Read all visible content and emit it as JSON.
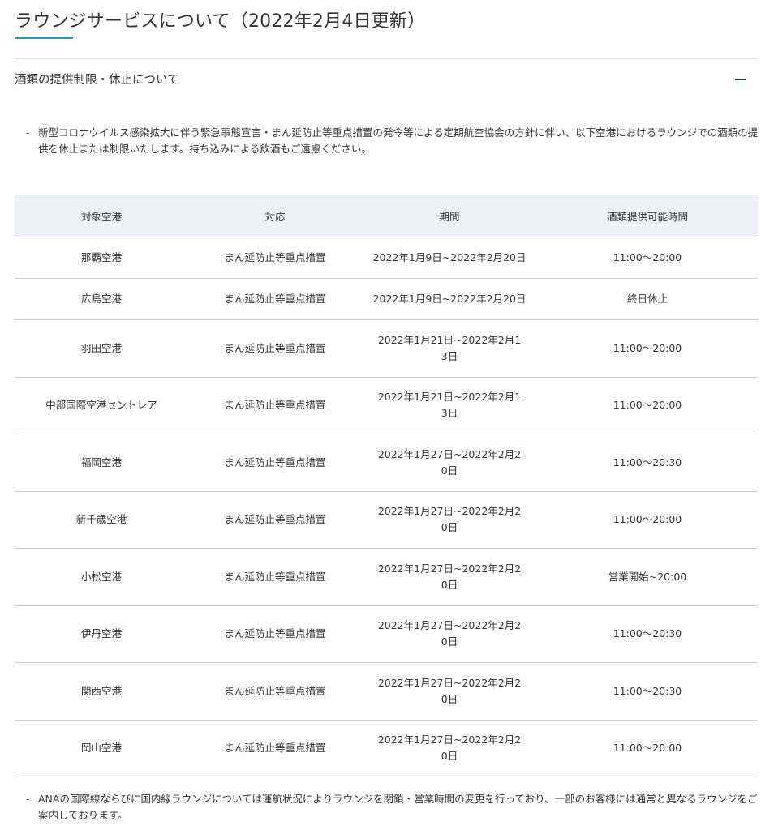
{
  "page": {
    "title": "ラウンジサービスについて（2022年2月4日更新）"
  },
  "accordion": {
    "title": "酒類の提供制限・休止について",
    "toggle_icon": "minus-icon"
  },
  "notes": {
    "top_dash": "-",
    "top": "新型コロナウイルス感染拡大に伴う緊急事態宣言・まん延防止等重点措置の発令等による定期航空協会の方針に伴い、以下空港におけるラウンジでの酒類の提供を休止または制限いたします。持ち込みによる飲酒もご遠慮ください。",
    "bottom_dash": "-",
    "bottom": "ANAの国際線ならびに国内線ラウンジについては運航状況によりラウンジを閉鎖・営業時間の変更を行っており、一部のお客様には通常と異なるラウンジをご案内しております。"
  },
  "table": {
    "headers": [
      "対象空港",
      "対応",
      "期間",
      "酒類提供可能時間"
    ],
    "rows": [
      {
        "airport": "那覇空港",
        "measure": "まん延防止等重点措置",
        "period": "2022年1月9日~2022年2月20日",
        "hours": "11:00～20:00"
      },
      {
        "airport": "広島空港",
        "measure": "まん延防止等重点措置",
        "period": "2022年1月9日~2022年2月20日",
        "hours": "終日休止"
      },
      {
        "airport": "羽田空港",
        "measure": "まん延防止等重点措置",
        "period": "2022年1月21日~2022年2月13日",
        "hours": "11:00～20:00"
      },
      {
        "airport": "中部国際空港セントレア",
        "measure": "まん延防止等重点措置",
        "period": "2022年1月21日~2022年2月13日",
        "hours": "11:00～20:00"
      },
      {
        "airport": "福岡空港",
        "measure": "まん延防止等重点措置",
        "period": "2022年1月27日~2022年2月20日",
        "hours": "11:00～20:30"
      },
      {
        "airport": "新千歳空港",
        "measure": "まん延防止等重点措置",
        "period": "2022年1月27日~2022年2月20日",
        "hours": "11:00～20:00"
      },
      {
        "airport": "小松空港",
        "measure": "まん延防止等重点措置",
        "period": "2022年1月27日~2022年2月20日",
        "hours": "営業開始~20:00"
      },
      {
        "airport": "伊丹空港",
        "measure": "まん延防止等重点措置",
        "period": "2022年1月27日~2022年2月20日",
        "hours": "11:00～20:30"
      },
      {
        "airport": "関西空港",
        "measure": "まん延防止等重点措置",
        "period": "2022年1月27日~2022年2月20日",
        "hours": "11:00～20:30"
      },
      {
        "airport": "岡山空港",
        "measure": "まん延防止等重点措置",
        "period": "2022年1月27日~2022年2月20日",
        "hours": "11:00～20:00"
      }
    ]
  },
  "colors": {
    "accent": "#1a9cc8",
    "icon": "#1b3f73",
    "header_bg": "#eef1f7"
  }
}
